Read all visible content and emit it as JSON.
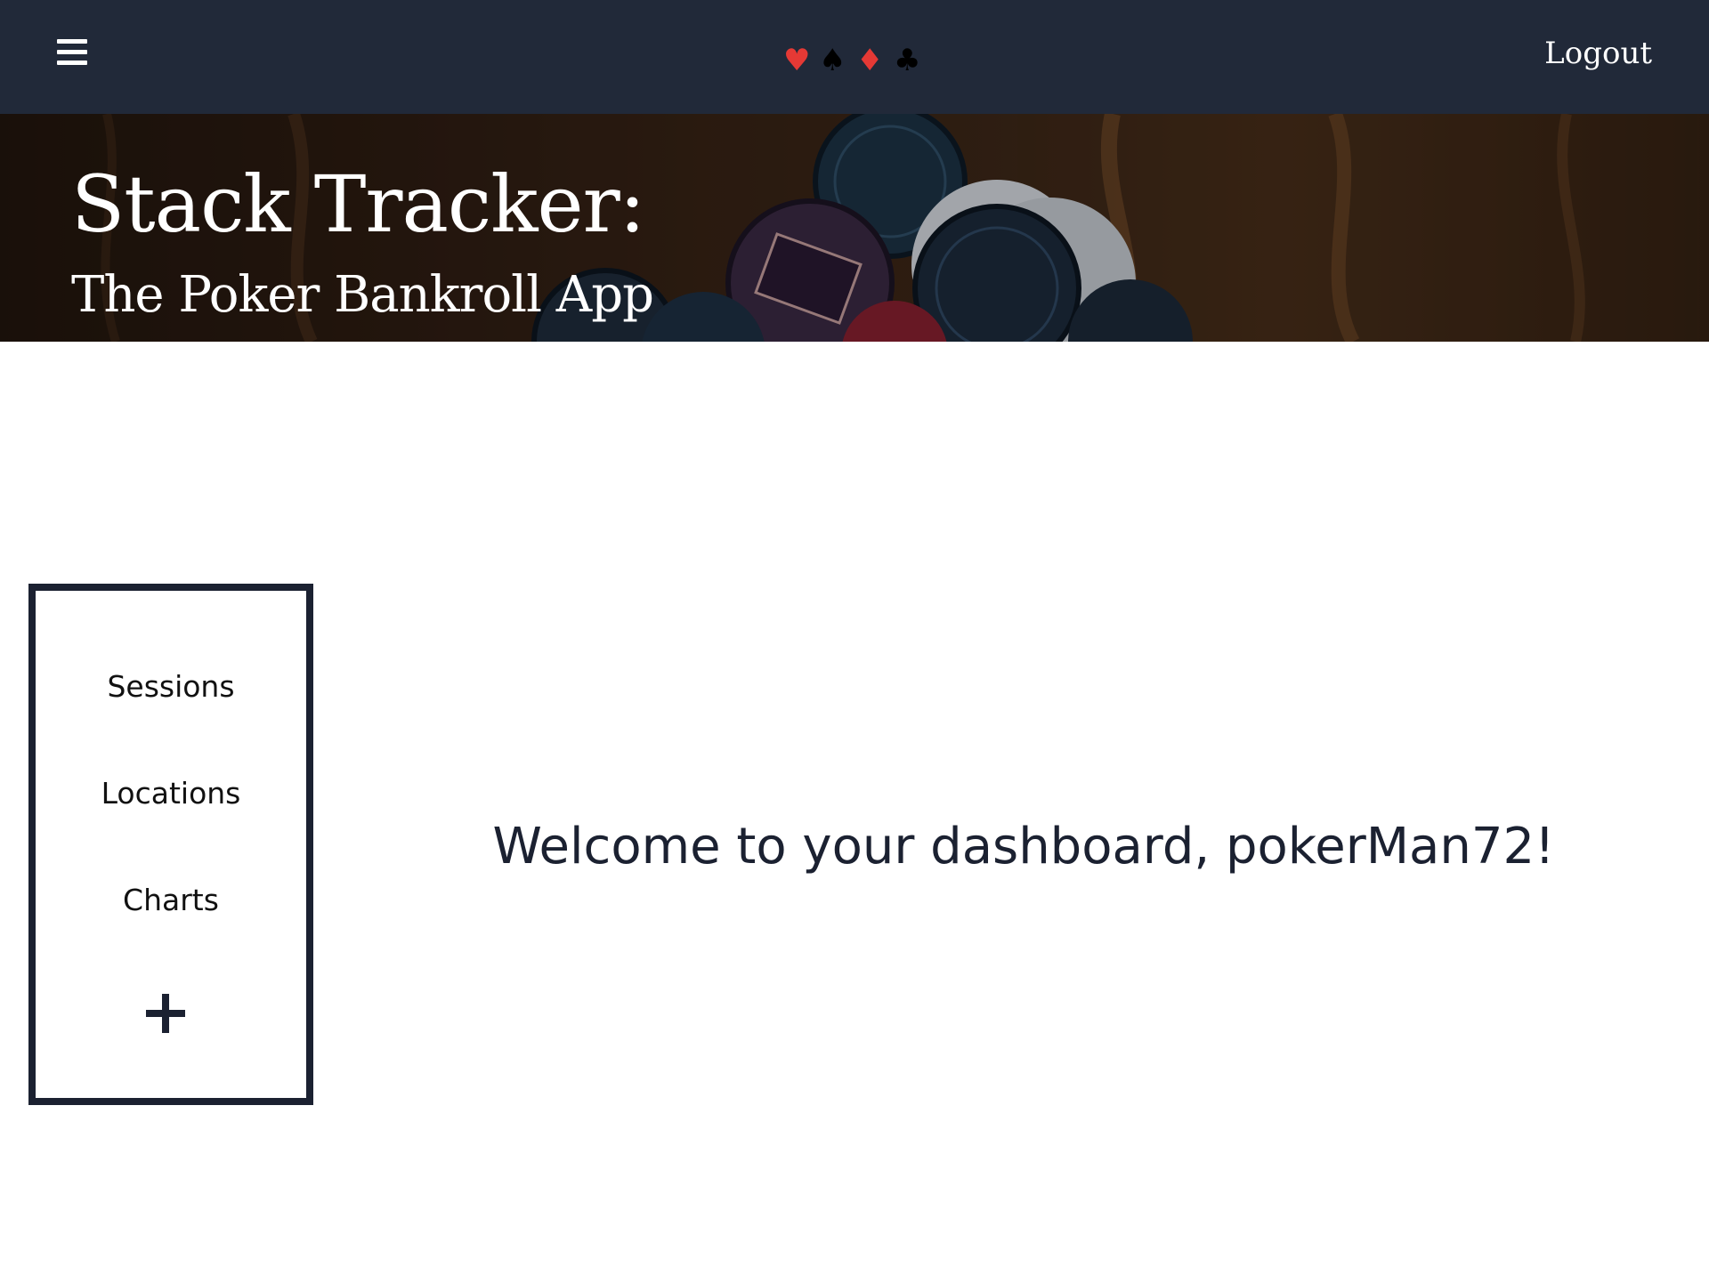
{
  "navbar": {
    "menu_icon": "hamburger-menu-icon",
    "suits": [
      {
        "glyph": "♥",
        "name": "heart-suit-icon",
        "color": "#e53935"
      },
      {
        "glyph": "♠",
        "name": "spade-suit-icon",
        "color": "#000000"
      },
      {
        "glyph": "♦",
        "name": "diamond-suit-icon",
        "color": "#e53935"
      },
      {
        "glyph": "♣",
        "name": "club-suit-icon",
        "color": "#000000"
      }
    ],
    "logout_label": "Logout",
    "background_color": "#212939"
  },
  "banner": {
    "title": "Stack Tracker:",
    "subtitle": "The Poker Bankroll App"
  },
  "sidebar": {
    "items": [
      {
        "label": "Sessions"
      },
      {
        "label": "Locations"
      },
      {
        "label": "Charts"
      }
    ],
    "add_icon": "plus-icon",
    "border_color": "#1b2131"
  },
  "main": {
    "welcome": "Welcome to your dashboard, pokerMan72!"
  }
}
